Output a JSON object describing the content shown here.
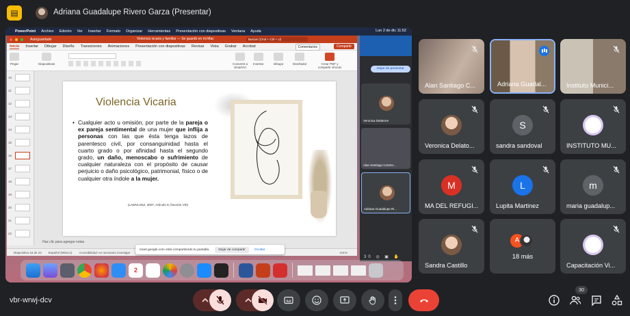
{
  "header": {
    "presenter_name": "Adriana Guadalupe Rivero Garza (Presentar)"
  },
  "mac_menu": {
    "items": [
      "PowerPoint",
      "Archivo",
      "Edición",
      "Ver",
      "Insertar",
      "Formato",
      "Organizar",
      "Herramientas",
      "Presentación con diapositivas",
      "Ventana",
      "Ayuda"
    ],
    "clock": "Lun 2 de dic 11:52"
  },
  "powerpoint": {
    "autosave": "Autoguardado",
    "doc_title": "Violencia vicaria y familiar — Se guardó en mi Mac",
    "search": "Buscar (Cmd + Ctrl + U)",
    "tabs": [
      "Inicio",
      "Insertar",
      "Dibujar",
      "Diseño",
      "Transiciones",
      "Animaciones",
      "Presentación con diapositivas",
      "Revisar",
      "Vista",
      "Grabar",
      "Acrobat"
    ],
    "comments": "Comentarios",
    "share": "Compartir",
    "ribbon": {
      "paste": "Pegar",
      "slides": "Diapositivas",
      "convert": "Convertir a SmartArt",
      "insert": "Insertar",
      "draw": "Dibujar",
      "designer": "Diseñador",
      "pdf": "Crear PDF y compartir vínculo"
    },
    "thumb_numbers": [
      "10",
      "11",
      "12",
      "13",
      "14",
      "15",
      "16",
      "17",
      "18",
      "19",
      "20",
      "21",
      "22"
    ],
    "notes_placeholder": "Haz clic para agregar notas",
    "status": {
      "slide": "Diapositiva 16 de 23",
      "language": "Español (México)",
      "accessibility": "Accesibilidad: es necesario investigar",
      "zoom": "101%"
    }
  },
  "slide": {
    "title": "Violencia Vicaria",
    "bullet": "•",
    "body": [
      {
        "t": "Cualquier acto u omisión, por parte de la ",
        "b": false
      },
      {
        "t": "pareja o ex pareja sentimental",
        "b": true
      },
      {
        "t": " de una mujer ",
        "b": false
      },
      {
        "t": "que inflija a personas",
        "b": true
      },
      {
        "t": " con las que ésta tenga lazos de parentesco civil, por consanguinidad hasta el cuarto grado o por afinidad hasta el segundo grado, ",
        "b": false
      },
      {
        "t": "un daño, menoscabo o sufrimiento",
        "b": true
      },
      {
        "t": " de cualquier naturaleza con el propósito de causar perjuicio o daño psicológico, patrimonial, físico o de cualquier otra índole ",
        "b": false
      },
      {
        "t": "a la mujer.",
        "b": true
      }
    ],
    "citation": "(LAMVLVEZ, 2007, Artículo 9, fracción VIII)"
  },
  "share_notice": {
    "text": "meet.google.com está compartiendo tu pantalla.",
    "stop": "Dejar de compartir",
    "hide": "Ocultar"
  },
  "inner_meet": {
    "present_btn": "Dejar de presentar",
    "tiles": [
      "Veronica Delatorre",
      "Alan Santiago Contrer...",
      "Adriana Guadalupe Ri..."
    ],
    "count": "30"
  },
  "participants": [
    {
      "name": "Alan Santiago C...",
      "type": "video",
      "muted": true
    },
    {
      "name": "Adriana Guadal...",
      "type": "video",
      "speaking": true
    },
    {
      "name": "Instituto Munici...",
      "type": "video",
      "muted": true
    },
    {
      "name": "Veronica Delato...",
      "type": "photo",
      "muted": true
    },
    {
      "name": "sandra sandoval",
      "type": "letter",
      "letter": "S",
      "color": "#5f6368",
      "muted": true
    },
    {
      "name": "INSTITUTO MU...",
      "type": "logo",
      "muted": true
    },
    {
      "name": "MA DEL REFUGI...",
      "type": "letter",
      "letter": "M",
      "color": "#d93025",
      "muted": true
    },
    {
      "name": "Lupita Martinez",
      "type": "letter",
      "letter": "L",
      "color": "#1a73e8",
      "muted": true
    },
    {
      "name": "maria guadalup...",
      "type": "letter",
      "letter": "m",
      "color": "#5f6368",
      "muted": true
    },
    {
      "name": "Sandra Castillo",
      "type": "photo",
      "muted": true
    },
    {
      "name": "18 más",
      "type": "more",
      "letter": "A"
    },
    {
      "name": "Capacitación Vi...",
      "type": "logo",
      "muted": true
    }
  ],
  "bottom": {
    "meeting_code": "vbr-wrwj-dcv",
    "participant_count": "30"
  },
  "colors": {
    "accent_blue": "#8ab4f8",
    "end_call_red": "#ea4335",
    "present_yellow": "#fbbc04"
  }
}
